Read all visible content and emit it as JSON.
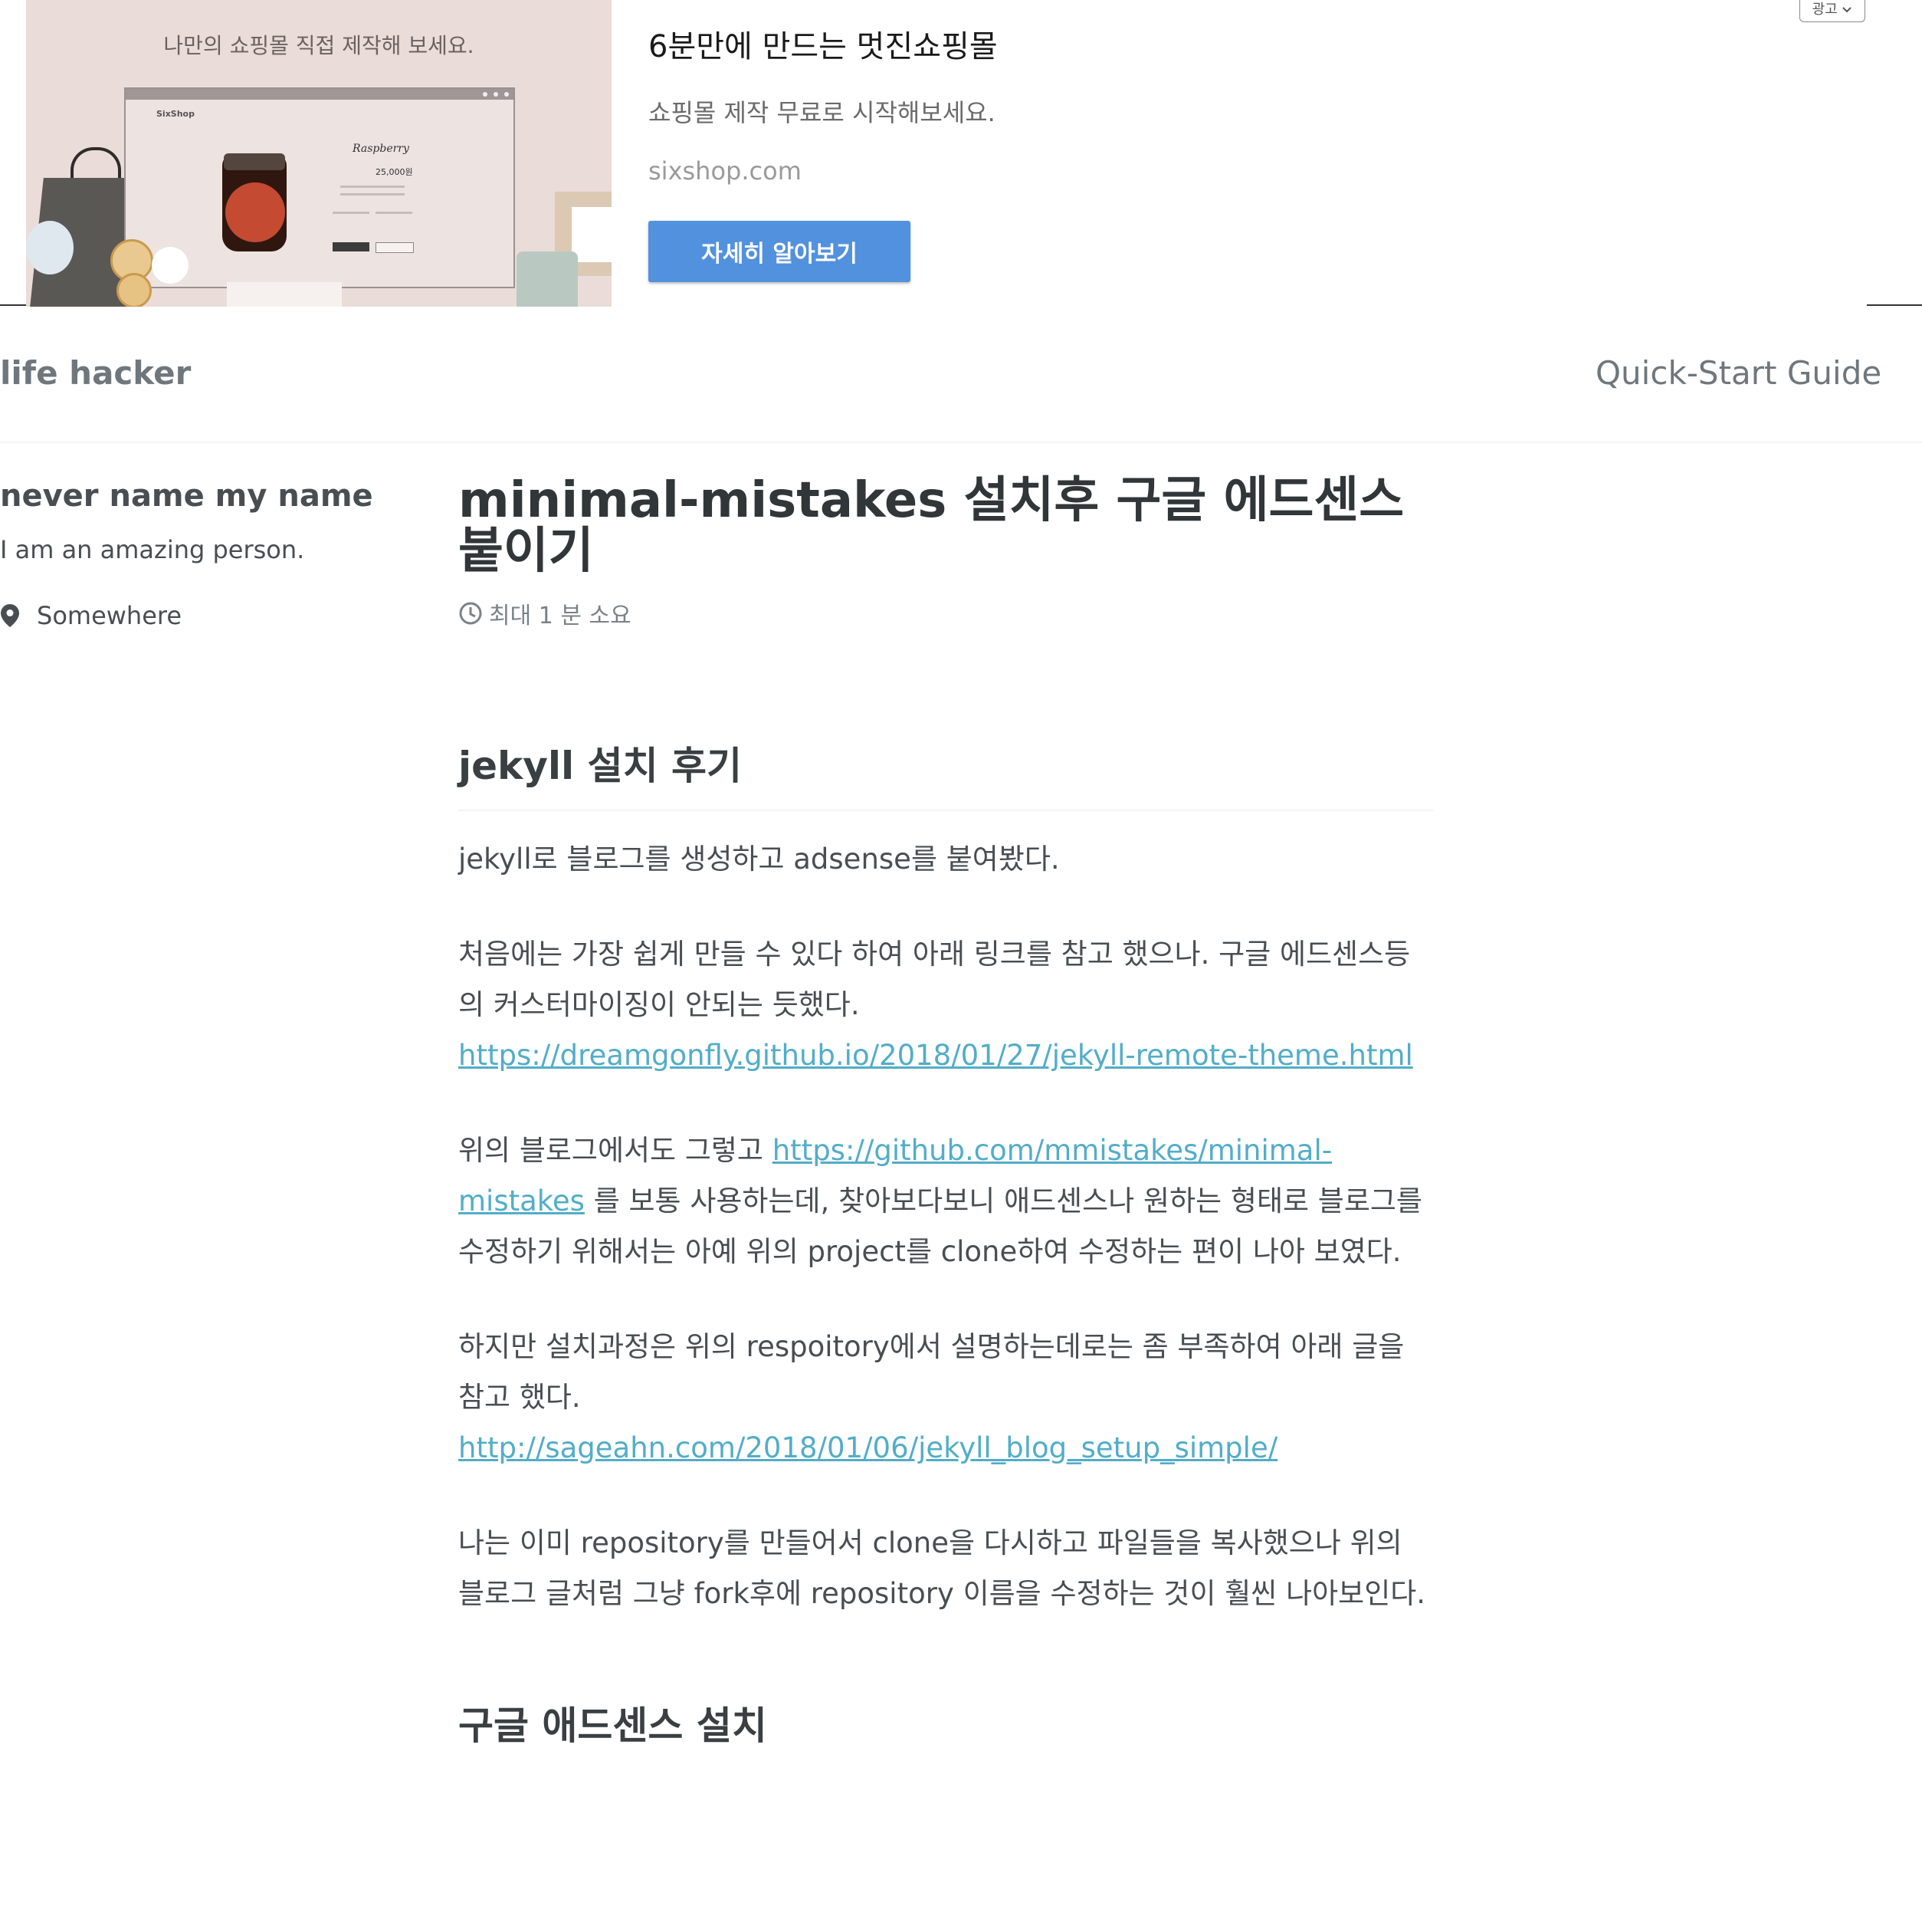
{
  "ad": {
    "image_caption": "나만의 쇼핑몰 직접 제작해 보세요.",
    "mock_brand": "SixShop",
    "mock_product": "Raspberry",
    "mock_price": "25,000원",
    "title": "6분만에 만드는 멋진쇼핑몰",
    "description": "쇼핑몰 제작 무료로 시작해보세요.",
    "domain": "sixshop.com",
    "cta_label": "자세히 알아보기",
    "badge_label": "광고",
    "cta_color": "#5291dd"
  },
  "masthead": {
    "site_title": "life hacker",
    "nav_link": "Quick-Start Guide"
  },
  "sidebar": {
    "author_name": "never name my name",
    "author_bio": "I am an amazing person.",
    "location": "Somewhere"
  },
  "post": {
    "title": "minimal-mistakes 설치후 구글 에드센스 붙이기",
    "read_time": "최대 1 분 소요",
    "section1_heading": "jekyll 설치 후기",
    "p1": "jekyll로 블로그를 생성하고 adsense를 붙여봤다.",
    "p2_text": "처음에는 가장 쉽게 만들 수 있다 하여 아래 링크를 참고 했으나. 구글 에드센스등의 커스터마이징이 안되는 듯했다.",
    "p2_link": "https://dreamgonfly.github.io/2018/01/27/jekyll-remote-theme.html",
    "p3_before": "위의 블로그에서도 그렇고 ",
    "p3_link": "https://github.com/mmistakes/minimal-mistakes",
    "p3_after": " 를 보통 사용하는데, 찾아보다보니 애드센스나 원하는 형태로 블로그를 수정하기 위해서는 아예 위의 project를 clone하여 수정하는 편이 나아 보였다.",
    "p4_text": "하지만 설치과정은 위의 respoitory에서 설명하는데로는 좀 부족하여 아래 글을 참고 했다.",
    "p4_link": "http://sageahn.com/2018/01/06/jekyll_blog_setup_simple/",
    "p5": "나는 이미 repository를 만들어서 clone을 다시하고 파일들을 복사했으나 위의 블로그 글처럼 그냥 fork후에 repository 이름을 수정하는 것이 훨씬 나아보인다.",
    "section2_heading": "구글 애드센스 설치"
  },
  "colors": {
    "link": "#52adc8",
    "text": "#494e52",
    "muted": "#7a8288",
    "masthead": "#6f777d"
  }
}
